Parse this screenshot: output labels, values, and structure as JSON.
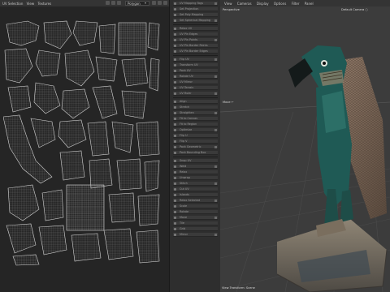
{
  "uv_editor": {
    "menu": [
      "UV Selection",
      "View",
      "Textures"
    ],
    "mode_select": "Polygon",
    "mode_arrow": "▾"
  },
  "middle_panel": {
    "rows": [
      "UV Mapping Tags",
      "Set Projection",
      "Set Poly Mapping",
      "Set Spherical Mapping",
      "Relax UV",
      "UV Pin Edges",
      "UV Pin Points",
      "UV Pin Border Points",
      "UV Pin Border Edges",
      "Flip UV",
      "Transform UV",
      "Pack UV",
      "Rotate UV",
      "UV Mirror",
      "UV Terrain",
      "UV Ruler",
      "Align",
      "Stretch",
      "Straighten",
      "Fit to Canvas",
      "Fit to Region",
      "Optimize",
      "Flip U",
      "Flip V",
      "Pack Geometric",
      "Pack Bounding Box",
      "Snap UV",
      "Weld",
      "Relax",
      "Unwrap",
      "Stitch",
      "Cut UV",
      "Islands",
      "Relax Selected",
      "Scale",
      "Rotate",
      "Move",
      "Tile",
      "Grid",
      "Mirror"
    ]
  },
  "viewport": {
    "menu": [
      "View",
      "Cameras",
      "Display",
      "Options",
      "Filter",
      "Panel"
    ],
    "perspective_label": "Perspective",
    "camera_label": "Default Camera ○",
    "axis_label": "Move ←",
    "status_label": "View Transform: Scene"
  },
  "colors": {
    "uv_wire": "#c9c9c9",
    "uv_bg": "#252525",
    "viewport_bg": "#3c3c3c",
    "statue_green": "#1f5a55",
    "statue_stone": "#8a7f70",
    "statue_wing": "#7a6a5a"
  }
}
